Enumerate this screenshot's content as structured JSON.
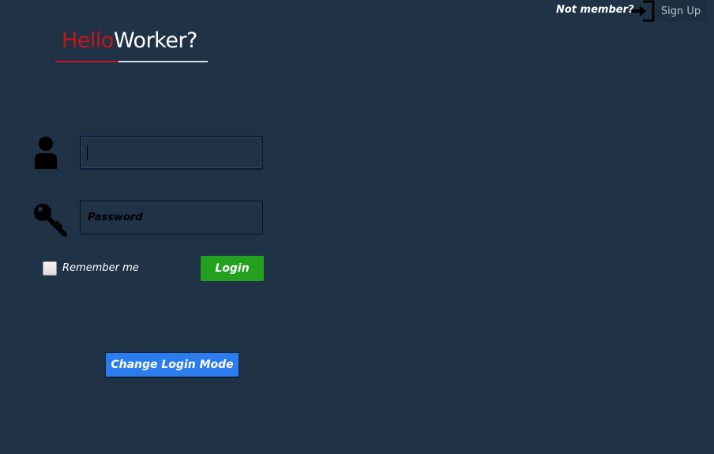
{
  "header": {
    "not_member_text": "Not member?",
    "signup_icon": "sign-in-arrow-icon",
    "signup_label": "Sign Up"
  },
  "logo": {
    "part1": "Hello",
    "part2": "Worker?",
    "colors": {
      "hello": "#c4161c",
      "worker": "#ffffff"
    }
  },
  "form": {
    "username_icon": "user-icon",
    "username_value": "",
    "password_icon": "key-icon",
    "password_placeholder": "Password",
    "remember_label": "Remember me",
    "remember_checked": false,
    "login_label": "Login"
  },
  "footer": {
    "change_mode_label": "Change Login Mode"
  },
  "colors": {
    "background": "#203246",
    "login_button": "#22a01e",
    "mode_button": "#2b7ced",
    "accent_red": "#c4161c"
  }
}
